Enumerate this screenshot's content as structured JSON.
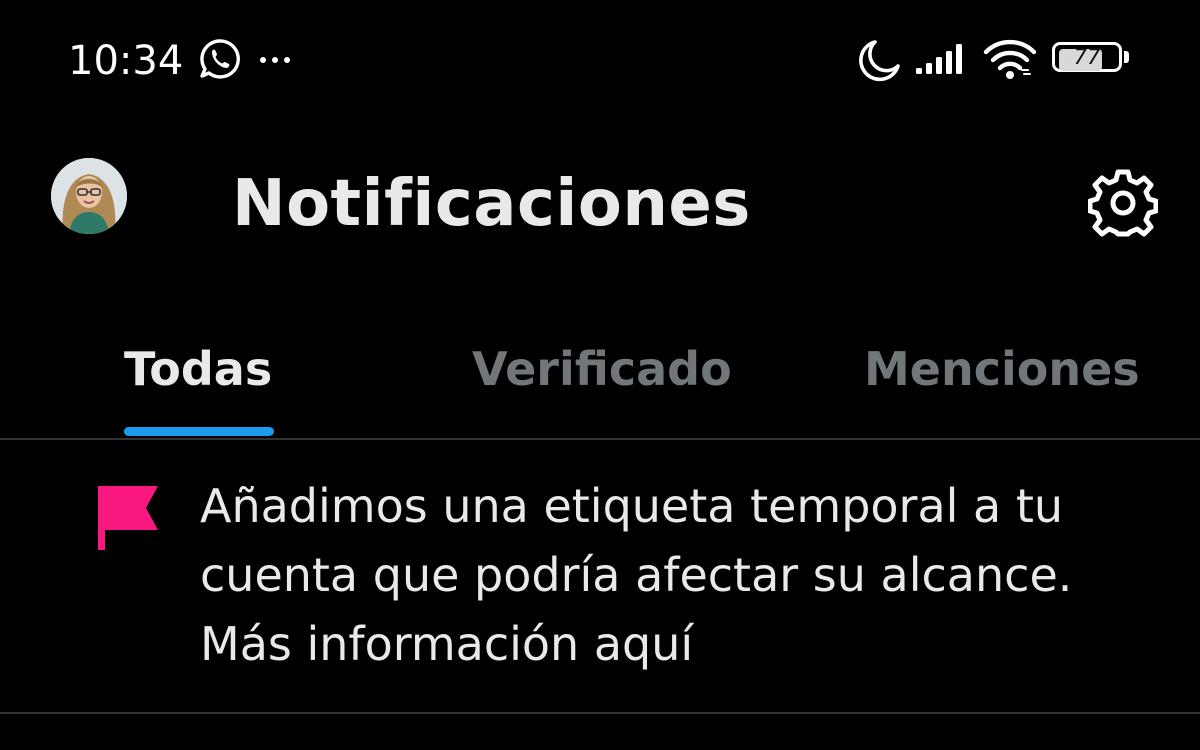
{
  "status_bar": {
    "time": "10:34",
    "battery_level": "77",
    "battery_fraction": 0.77,
    "icons": [
      "whatsapp-icon",
      "more-dots-icon",
      "moon-icon",
      "signal-icon",
      "wifi-icon",
      "battery-icon"
    ]
  },
  "header": {
    "title": "Notificaciones",
    "icons": [
      "avatar",
      "gear-icon"
    ]
  },
  "tabs": [
    {
      "label": "Todas",
      "active": true
    },
    {
      "label": "Verificado",
      "active": false
    },
    {
      "label": "Menciones",
      "active": false
    }
  ],
  "notification": {
    "icon": "flag-icon",
    "text": "Añadimos una etiqueta temporal a tu cuenta que podría afectar su alcance. Más información aquí"
  },
  "colors": {
    "background": "#000000",
    "text_primary": "#e7e9ea",
    "text_secondary": "#71767b",
    "accent": "#1d9bf0",
    "flag": "#f91880",
    "divider": "#2f3336"
  }
}
